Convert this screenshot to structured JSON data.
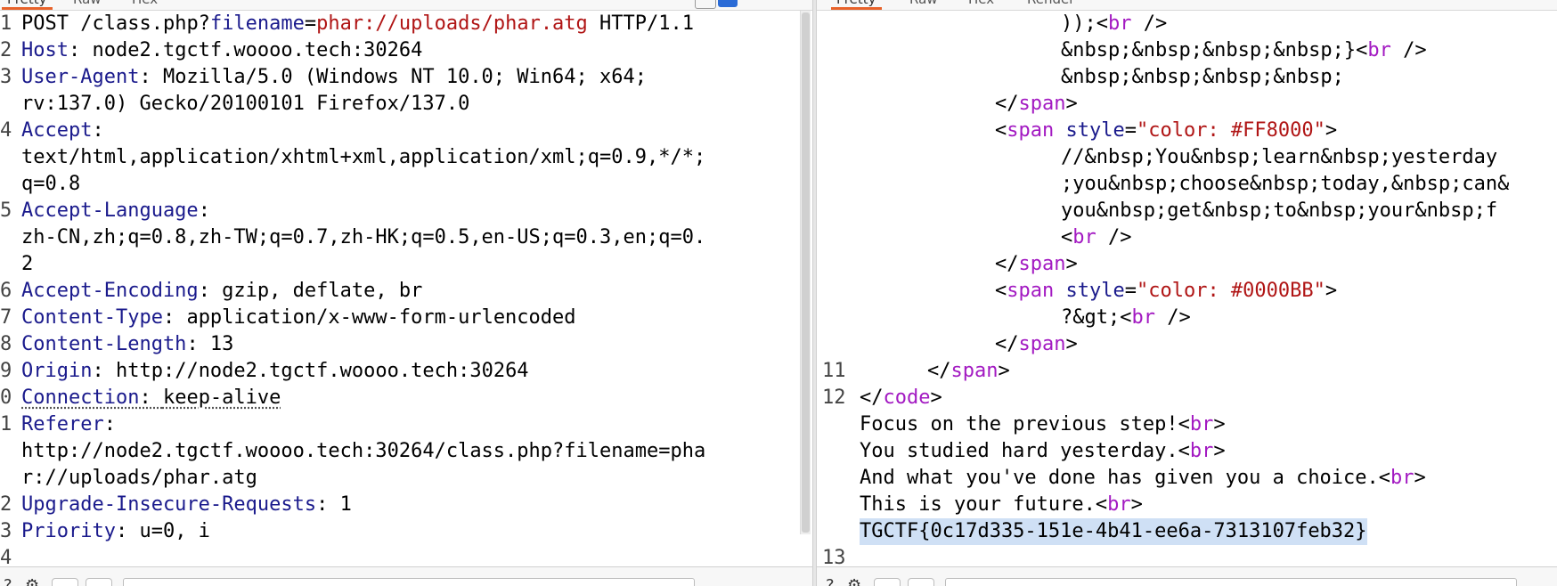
{
  "left_tabs": [
    "Pretty",
    "Raw",
    "Hex"
  ],
  "right_tabs": [
    "Pretty",
    "Raw",
    "Hex",
    "Render"
  ],
  "request": {
    "method": "POST",
    "path_prefix": "/class.php?",
    "param_name": "filename",
    "equals": "=",
    "param_value": "phar://uploads/phar.atg",
    "protocol": "HTTP/1.1",
    "line_numbers": [
      "1",
      "2",
      "3",
      "4",
      "5",
      "6",
      "7",
      "8",
      "9",
      "0",
      "1",
      "2",
      "3",
      "4"
    ],
    "host_name": "Host",
    "host_value": ": node2.tgctf.woooo.tech:30264",
    "ua_name": "User-Agent",
    "ua_value_1": ": Mozilla/5.0 (Windows NT 10.0; Win64; x64;",
    "ua_value_2": "rv:137.0) Gecko/20100101 Firefox/137.0",
    "accept_name": "Accept",
    "accept_colon": ":",
    "accept_value_1": "text/html,application/xhtml+xml,application/xml;q=0.9,*/*;",
    "accept_value_2": "q=0.8",
    "lang_name": "Accept-Language",
    "lang_colon": ":",
    "lang_value_1": "zh-CN,zh;q=0.8,zh-TW;q=0.7,zh-HK;q=0.5,en-US;q=0.3,en;q=0.",
    "lang_value_2": "2",
    "enc_name": "Accept-Encoding",
    "enc_value": ": gzip, deflate, br",
    "ctype_name": "Content-Type",
    "ctype_value": ": application/x-www-form-urlencoded",
    "clen_name": "Content-Length",
    "clen_value": ": 13",
    "origin_name": "Origin",
    "origin_value": ": http://node2.tgctf.woooo.tech:30264",
    "conn_name": "Connection",
    "conn_colon": ": ",
    "conn_value": "keep-alive",
    "ref_name": "Referer",
    "ref_colon": ":",
    "ref_value_1": "http://node2.tgctf.woooo.tech:30264/class.php?filename=pha",
    "ref_value_2": "r://uploads/phar.atg",
    "uir_name": "Upgrade-Insecure-Requests",
    "uir_value": ": 1",
    "prio_name": "Priority",
    "prio_value": ": u=0, i"
  },
  "response": {
    "l1_pre": "));<",
    "l1_tag": "br",
    "l1_post": " />",
    "l2_pre": "&nbsp;&nbsp;&nbsp;&nbsp;}<",
    "l2_tag": "br",
    "l2_post": " />",
    "l3": "&nbsp;&nbsp;&nbsp;&nbsp;",
    "span_close_open": "</",
    "span_tag": "span",
    "close_gt": ">",
    "open_lt": "<",
    "style_attr": "style",
    "eq": "=",
    "color_ff": "\"color: #FF8000\"",
    "comment_1": "//&nbsp;You&nbsp;learn&nbsp;yesterday",
    "comment_2": ";you&nbsp;choose&nbsp;today,&nbsp;can&",
    "comment_3": "you&nbsp;get&nbsp;to&nbsp;your&nbsp;f",
    "br_tag": "br",
    "br_self": " />",
    "color_bb": "\"color: #0000BB\"",
    "php_close": "?&gt;<",
    "ln_11": "11",
    "ln_12": "12",
    "ln_13": "13",
    "code_tag": "code",
    "text_1": "Focus on the previous step!<",
    "text_2": "You studied hard yesterday.<",
    "text_3": "And what you've done has given you a choice.<",
    "text_4": "This is your future.<",
    "flag": "TGCTF{0c17d335-151e-4b41-ee6a-7313107feb32}"
  },
  "colors": {
    "header_name": "#1a1a8c",
    "param_value": "#b01515",
    "tag": "#a31ac2",
    "string": "#b01515",
    "active_tab": "#e8622a",
    "selection": "#cfe0f5"
  }
}
